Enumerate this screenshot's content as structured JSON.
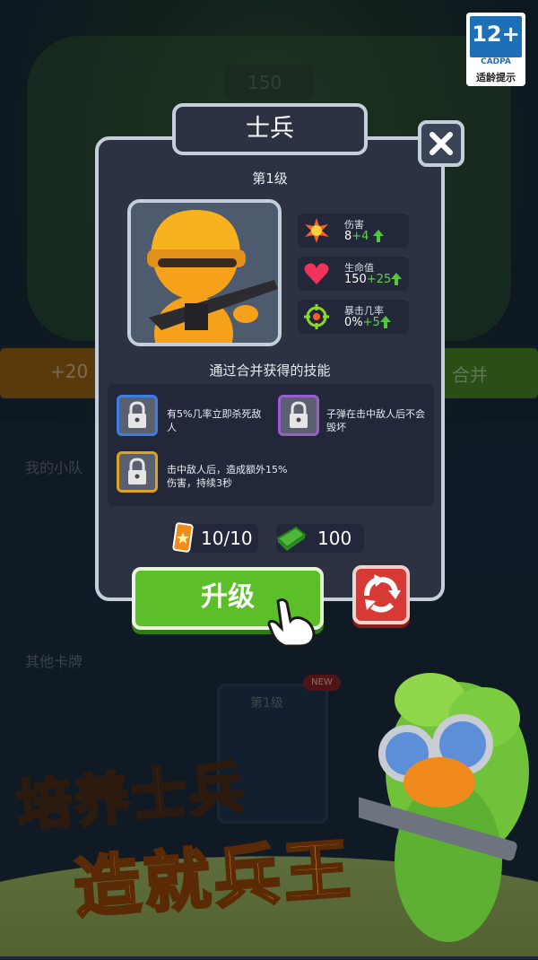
{
  "rating": {
    "age": "12+",
    "org": "CADPA",
    "tip": "适龄提示"
  },
  "background": {
    "price": "150",
    "bonus_text": "+20",
    "merge_text": "合并",
    "my_squad": "我的小队",
    "other_cards": "其他卡牌",
    "card_level": "第1级",
    "new_badge": "NEW"
  },
  "dialog": {
    "title": "士兵",
    "level": "第1级",
    "stats": [
      {
        "name": "伤害",
        "value": "8",
        "increase": "+4",
        "icon": "explosion-icon"
      },
      {
        "name": "生命值",
        "value": "150",
        "increase": "+25",
        "icon": "heart-icon"
      },
      {
        "name": "暴击几率",
        "value": "0%",
        "increase": "+5",
        "icon": "crosshair-icon"
      }
    ],
    "skills_title": "通过合并获得的技能",
    "skills": [
      {
        "text": "有5%几率立即杀死敌人",
        "border": "#3b7de0"
      },
      {
        "text": "子弹在击中敌人后不会毁坏",
        "border": "#9b5ad0"
      },
      {
        "text": "击中敌人后，造成额外15%伤害，持续3秒",
        "border": "#e0a020"
      }
    ],
    "cards": "10/10",
    "cash": "100",
    "upgrade_label": "升级"
  },
  "promo": {
    "line1": "培养士兵",
    "line2": "造就兵王"
  }
}
